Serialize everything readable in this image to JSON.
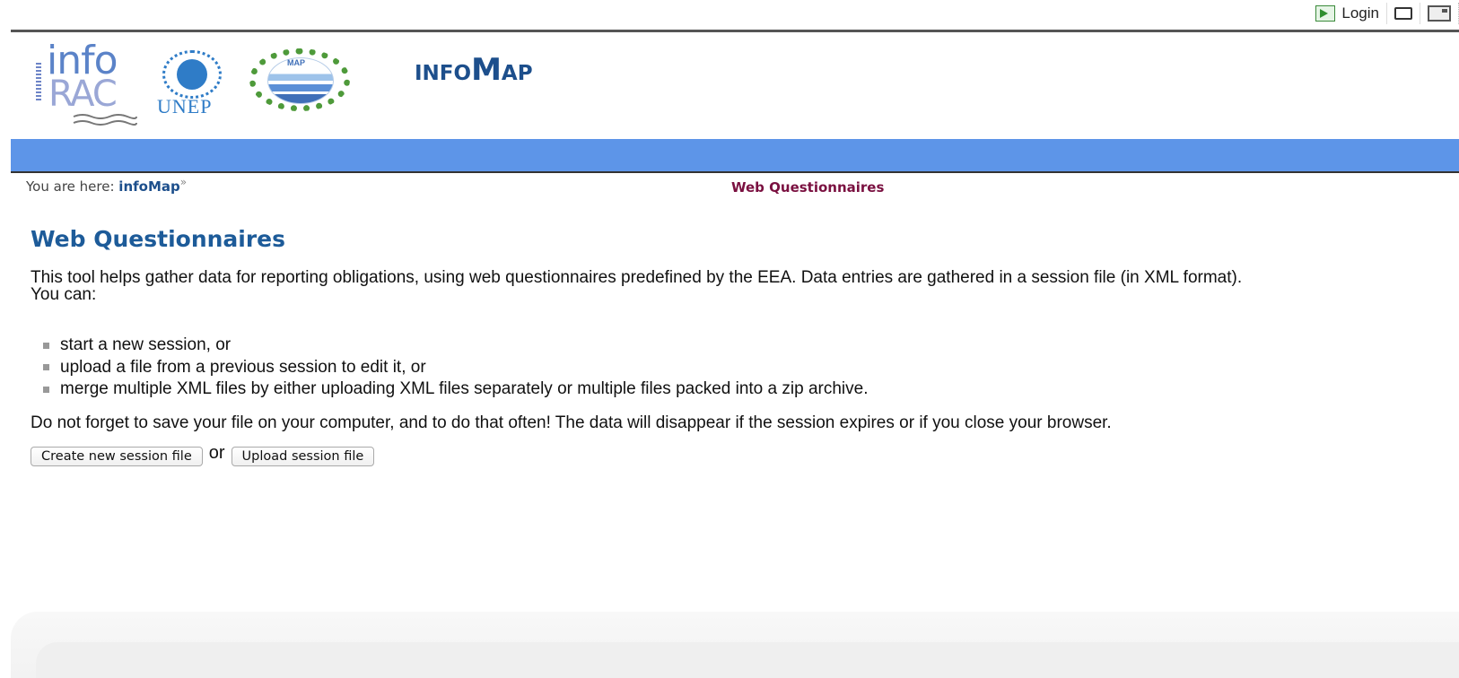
{
  "toolbar": {
    "login_label": "Login",
    "login_icon": "login-arrow-icon",
    "print_icon": "printer-icon",
    "fullscreen_icon": "fullscreen-icon"
  },
  "logos": {
    "info_top": "info",
    "info_bottom": "RAC",
    "unep": "UNEP",
    "map": "MAP"
  },
  "site": {
    "title_small_1": "INFO",
    "title_cap": "M",
    "title_small_2": "AP"
  },
  "breadcrumb": {
    "prefix": "You are here:",
    "link": "infoMap",
    "separator": "»",
    "current": "Web Questionnaires"
  },
  "main": {
    "heading": "Web Questionnaires",
    "intro_line1": "This tool helps gather data for reporting obligations, using web questionnaires predefined by the EEA. Data entries are gathered in a session file (in XML format).",
    "intro_line2": "You can:",
    "bullets": [
      "start a new session, or",
      "upload a file from a previous session to edit it, or",
      "merge multiple XML files by either uploading XML files separately or multiple files packed into a zip archive."
    ],
    "warning": "Do not forget to save your file on your computer, and to do that often! The data will disappear if the session expires or if you close your browser.",
    "create_button": "Create new session file",
    "or_text": "or",
    "upload_button": "Upload session file"
  },
  "colors": {
    "band": "#5d95e8",
    "heading": "#1d5b99",
    "current_crumb": "#7a1040"
  }
}
